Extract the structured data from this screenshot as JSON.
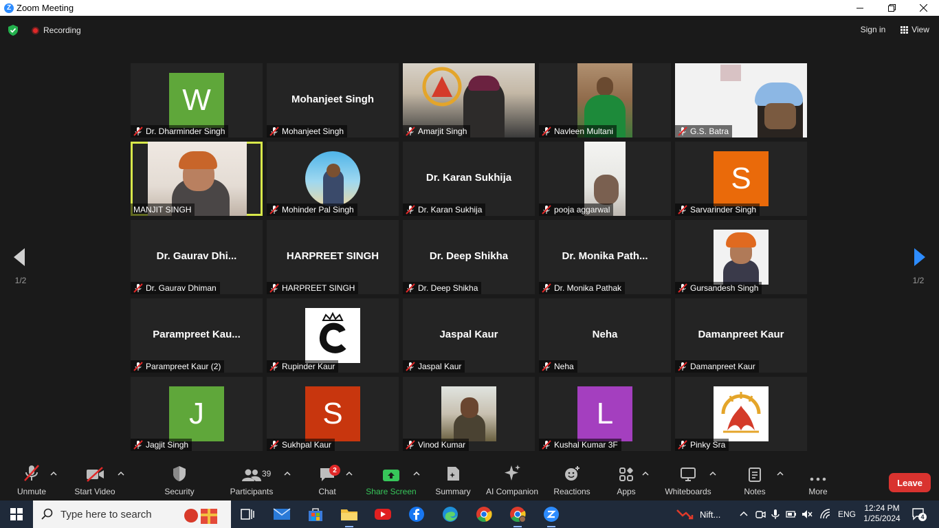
{
  "window": {
    "title": "Zoom Meeting"
  },
  "topbar": {
    "recording_label": "Recording",
    "signin_label": "Sign in",
    "view_label": "View"
  },
  "participants": [
    {
      "display": "letter",
      "letter": "W",
      "color": "#5fa73a",
      "name": "Dr. Dharminder Singh",
      "muted": true
    },
    {
      "display": "text",
      "bigname": "Mohanjeet Singh",
      "name": "Mohanjeet Singh",
      "muted": true
    },
    {
      "display": "photo",
      "name": "Amarjit Singh",
      "muted": true
    },
    {
      "display": "photo",
      "name": "Navleen Multani",
      "muted": true
    },
    {
      "display": "photo",
      "name": "G.S. Batra",
      "muted": true
    },
    {
      "display": "photo",
      "name": "MANJIT SINGH",
      "muted": false,
      "active": true
    },
    {
      "display": "photo",
      "name": "Mohinder Pal Singh",
      "muted": true
    },
    {
      "display": "text",
      "bigname": "Dr. Karan Sukhija",
      "name": "Dr. Karan Sukhija",
      "muted": true
    },
    {
      "display": "photo",
      "name": "pooja aggarwal",
      "muted": true
    },
    {
      "display": "letter",
      "letter": "S",
      "color": "#ea6a0a",
      "name": "Sarvarinder Singh",
      "muted": true
    },
    {
      "display": "text",
      "bigname": "Dr. Gaurav  Dhi...",
      "name": "Dr. Gaurav Dhiman",
      "muted": true
    },
    {
      "display": "text",
      "bigname": "HARPREET SINGH",
      "name": "HARPREET SINGH",
      "muted": true
    },
    {
      "display": "text",
      "bigname": "Dr. Deep Shikha",
      "name": "Dr. Deep Shikha",
      "muted": true
    },
    {
      "display": "text",
      "bigname": "Dr.  Monika  Path...",
      "name": "Dr. Monika Pathak",
      "muted": true
    },
    {
      "display": "photo",
      "name": "Gursandesh Singh",
      "muted": true
    },
    {
      "display": "text",
      "bigname": "Parampreet  Kau...",
      "name": "Parampreet Kaur (2)",
      "muted": true
    },
    {
      "display": "photo",
      "name": "Rupinder Kaur",
      "muted": true
    },
    {
      "display": "text",
      "bigname": "Jaspal Kaur",
      "name": "Jaspal Kaur",
      "muted": true
    },
    {
      "display": "text",
      "bigname": "Neha",
      "name": "Neha",
      "muted": true
    },
    {
      "display": "text",
      "bigname": "Damanpreet Kaur",
      "name": "Damanpreet Kaur",
      "muted": true
    },
    {
      "display": "letter",
      "letter": "J",
      "color": "#5fa73a",
      "name": "Jagjit Singh",
      "muted": true
    },
    {
      "display": "letter",
      "letter": "S",
      "color": "#c8360e",
      "name": "Sukhpal Kaur",
      "muted": true
    },
    {
      "display": "photo",
      "name": "Vinod Kumar",
      "muted": true
    },
    {
      "display": "letter",
      "letter": "L",
      "color": "#a43fbf",
      "name": "Kushal Kumar 3F",
      "muted": true
    },
    {
      "display": "photo",
      "name": "Pinky Sra",
      "muted": true
    }
  ],
  "pagination": {
    "left": "1/2",
    "right": "1/2"
  },
  "toolbar": {
    "unmute": "Unmute",
    "start_video": "Start Video",
    "security": "Security",
    "participants": "Participants",
    "participants_count": "39",
    "chat": "Chat",
    "chat_badge": "2",
    "share_screen": "Share Screen",
    "summary": "Summary",
    "ai_companion": "AI Companion",
    "reactions": "Reactions",
    "apps": "Apps",
    "whiteboards": "Whiteboards",
    "notes": "Notes",
    "more": "More",
    "leave": "Leave"
  },
  "taskbar": {
    "search_placeholder": "Type here to search",
    "nift_label": "Nift...",
    "lang": "ENG",
    "time": "12:24 PM",
    "date": "1/25/2024",
    "notifications": "4"
  },
  "colors": {
    "accent_green": "#37c65a",
    "leave_red": "#d9332f",
    "active_speaker": "#d8e84a",
    "zoom_blue": "#2d8cff"
  }
}
